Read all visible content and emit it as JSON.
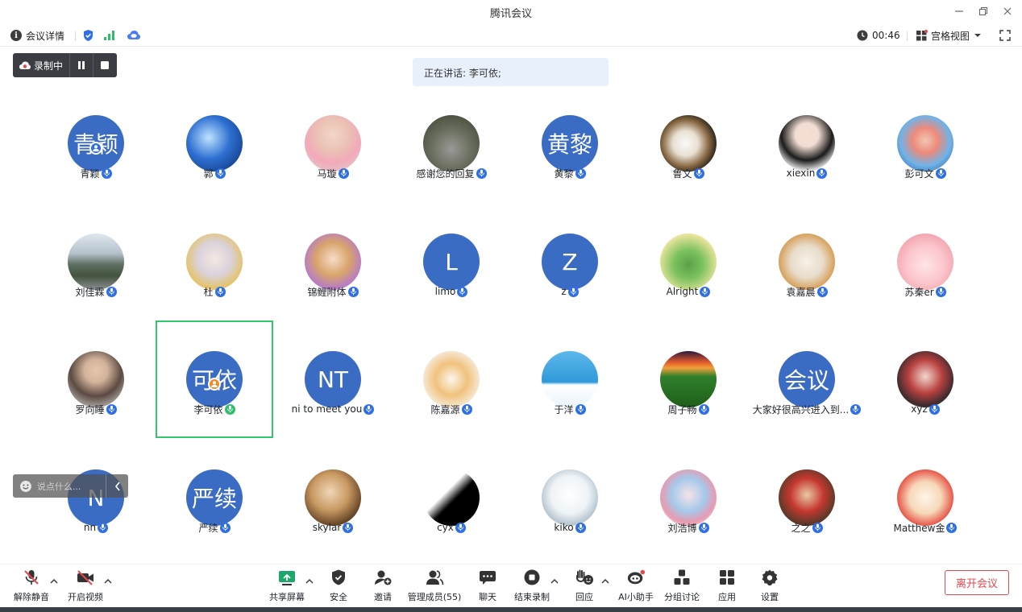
{
  "window": {
    "title": "腾讯会议"
  },
  "infobar": {
    "meeting_details": "会议详情",
    "timer": "00:46",
    "view_mode": "宫格视图"
  },
  "recording": {
    "label": "录制中"
  },
  "speaking": {
    "text": "正在讲话: 李可依;"
  },
  "chat": {
    "placeholder": "说点什么..."
  },
  "participants": [
    {
      "name": "青颖",
      "avatar_text": "青颖",
      "avatar_color": "#3b6cc4",
      "role_badge": "host"
    },
    {
      "name": "郭",
      "avatar": "blue-light-streaks-photo"
    },
    {
      "name": "马璇",
      "avatar": "girl-with-flowers-photo"
    },
    {
      "name": "感谢您的回复",
      "avatar": "sleeping-cat-photo"
    },
    {
      "name": "黄黎",
      "avatar_text": "黄黎",
      "avatar_color": "#3b6cc4"
    },
    {
      "name": "鲁文",
      "avatar": "duck-and-bird-photo"
    },
    {
      "name": "xiexin",
      "avatar": "smiling-woman-portrait"
    },
    {
      "name": "彭可文",
      "avatar": "girl-with-cat-illustration"
    },
    {
      "name": "刘佳霖",
      "avatar": "mountain-road-landscape"
    },
    {
      "name": "杜",
      "avatar": "anime-boy-silver-hair"
    },
    {
      "name": "锦鲤附体",
      "avatar": "costume-girl-illustration"
    },
    {
      "name": "limo",
      "avatar_text": "L",
      "avatar_color": "#3b6cc4"
    },
    {
      "name": "z",
      "avatar_text": "Z",
      "avatar_color": "#3b6cc4"
    },
    {
      "name": "Alright",
      "avatar": "green-frog-cartoon"
    },
    {
      "name": "袁嘉晨",
      "avatar": "cat-eating-noodles-cartoon"
    },
    {
      "name": "苏秦er",
      "avatar": "pink-bunny-cartoon"
    },
    {
      "name": "罗向睡",
      "avatar": "man-in-suit-portrait"
    },
    {
      "name": "李可依",
      "avatar_text": "可依",
      "avatar_color": "#3b6cc4",
      "role_badge": "cohost",
      "speaking": true
    },
    {
      "name": "ni to meet you",
      "avatar_text": "NT",
      "avatar_color": "#3b6cc4"
    },
    {
      "name": "陈嘉源",
      "avatar": "cat-with-noodles-cartoon"
    },
    {
      "name": "于洋",
      "avatar": "person-on-snow-blue-sky"
    },
    {
      "name": "周子畅",
      "avatar": "green-field-sunset"
    },
    {
      "name": "大家好很高兴进入到...",
      "avatar_text": "会议",
      "avatar_color": "#3b6cc4"
    },
    {
      "name": "xyz",
      "avatar": "red-theme-anime-girl"
    },
    {
      "name": "nn",
      "avatar_text": "N",
      "avatar_color": "#3b6cc4"
    },
    {
      "name": "严续",
      "avatar_text": "严续",
      "avatar_color": "#3b6cc4"
    },
    {
      "name": "skylar",
      "avatar": "golden-girl-portrait"
    },
    {
      "name": "cyx",
      "avatar": "black-white-silhouette"
    },
    {
      "name": "kiko",
      "avatar": "cat-in-jar-cartoon"
    },
    {
      "name": "刘浩博",
      "avatar": "anime-girl-with-flowers"
    },
    {
      "name": "之之",
      "avatar": "red-hat-doll"
    },
    {
      "name": "Matthew金",
      "avatar": "laughing-cat-cartoon"
    }
  ],
  "toolbar": {
    "unmute": "解除静音",
    "start_video": "开启视频",
    "share_screen": "共享屏幕",
    "security": "安全",
    "invite": "邀请",
    "manage_members": "管理成员(55)",
    "chat": "聊天",
    "end_recording": "结束录制",
    "reactions": "回应",
    "ai_assistant": "AI小助手",
    "breakout": "分组讨论",
    "apps": "应用",
    "settings": "设置",
    "leave": "离开会议"
  },
  "colors": {
    "accent_blue": "#3b6cc4",
    "mic_blue": "#2e6fe6",
    "speaking_green": "#2fc86b",
    "leave_red": "#e5484d"
  }
}
